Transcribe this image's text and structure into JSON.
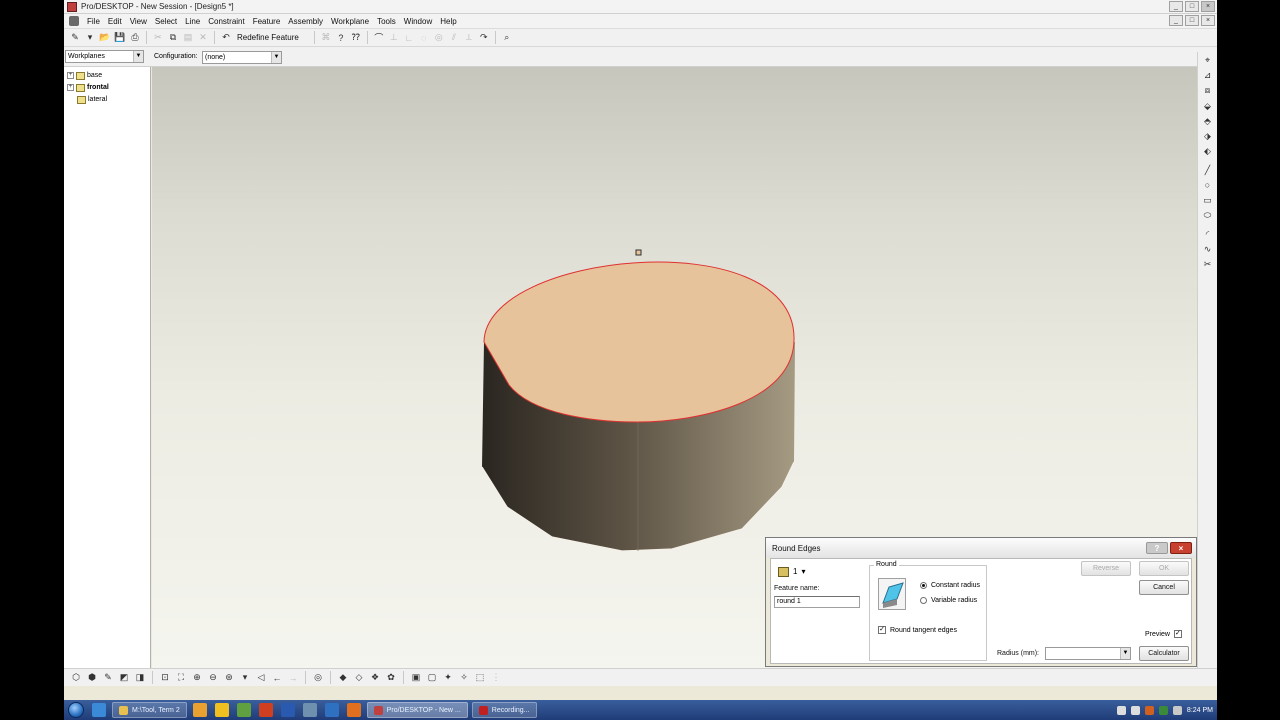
{
  "window": {
    "title": "Pro/DESKTOP - New Session - [Design5 *]",
    "buttons": [
      "_",
      "□",
      "×"
    ]
  },
  "menubar": {
    "items": [
      "File",
      "Edit",
      "View",
      "Select",
      "Line",
      "Constraint",
      "Feature",
      "Assembly",
      "Workplane",
      "Tools",
      "Window",
      "Help"
    ],
    "doc_buttons": [
      "_",
      "□",
      "×"
    ]
  },
  "toolbar": {
    "redefine_label": "Redefine Feature"
  },
  "selection": {
    "dropdown_value": "Workplanes",
    "configuration_label": "Configuration:",
    "configuration_value": "(none)"
  },
  "tree": {
    "items": [
      {
        "label": "base",
        "bold": false
      },
      {
        "label": "frontal",
        "bold": true
      },
      {
        "label": "lateral",
        "bold": false
      }
    ]
  },
  "model": {
    "top_color": "#e6c39a",
    "side_dark": "#2a2620",
    "side_light": "#a59a82",
    "edge_highlight": "#e03030"
  },
  "dialog": {
    "title": "Round Edges",
    "feature_number": "1",
    "feature_name_label": "Feature name:",
    "feature_name_value": "round 1",
    "group_label": "Round",
    "constant_radius": "Constant radius",
    "variable_radius": "Variable radius",
    "round_tangent": "Round tangent edges",
    "reverse_button": "Reverse",
    "ok_button": "OK",
    "cancel_button": "Cancel",
    "preview_label": "Preview",
    "radius_label": "Radius (mm):",
    "radius_value": "",
    "calculator_button": "Calculator",
    "help_symbol": "?",
    "close_symbol": "×"
  },
  "taskbar": {
    "buttons": [
      {
        "label": "M:\\Tool, Term 2",
        "active": false
      },
      {
        "label": "Pro/DESKTOP - New ...",
        "active": true
      },
      {
        "label": "Recording...",
        "active": false
      }
    ],
    "clock": "8:24 PM"
  }
}
